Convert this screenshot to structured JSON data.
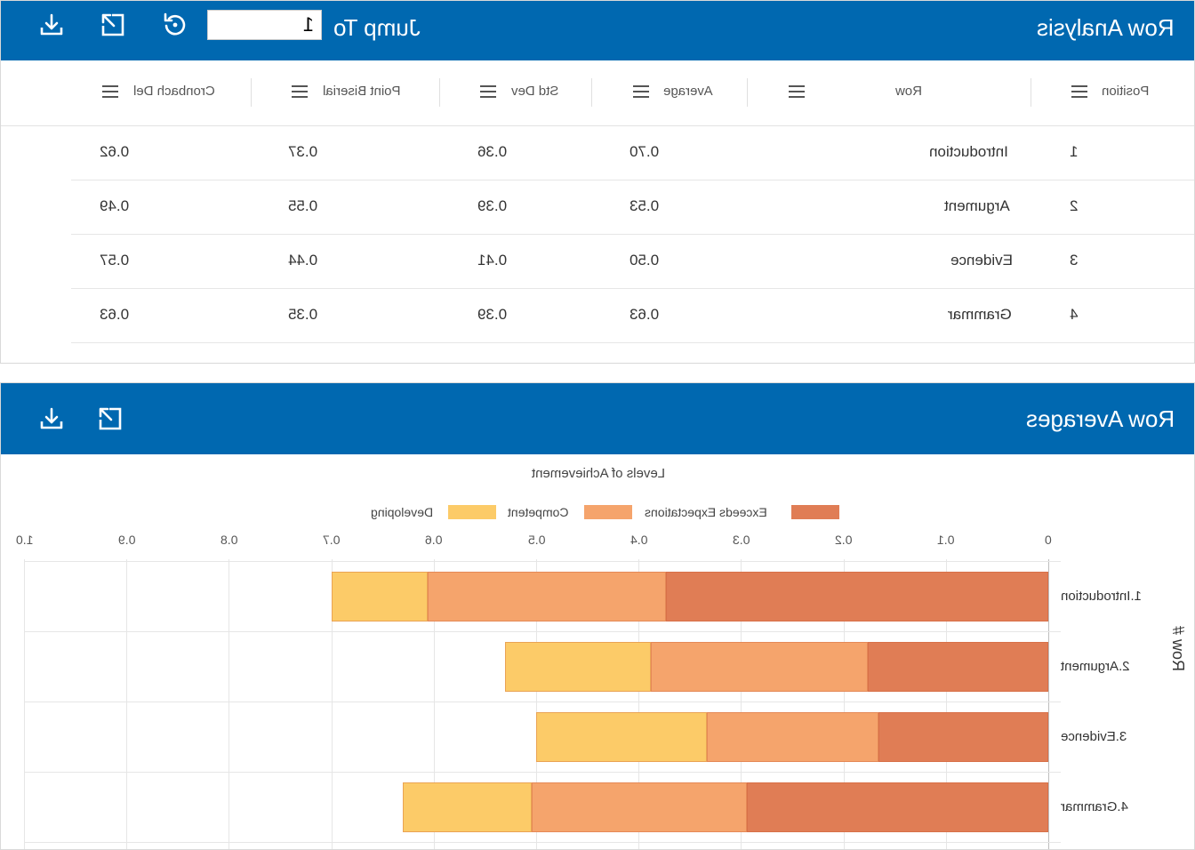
{
  "analysis": {
    "title": "Row Analysis",
    "jump_label": "Jump To",
    "jump_value": "1",
    "columns": [
      "Position",
      "Row",
      "Average",
      "Std Dev",
      "Point Biserial",
      "Cronbach Del"
    ],
    "rows": [
      {
        "position": "1",
        "row": "Introduction",
        "average": "0.70",
        "std_dev": "0.36",
        "point_biserial": "0.37",
        "cronbach_del": "0.62"
      },
      {
        "position": "2",
        "row": "Argument",
        "average": "0.53",
        "std_dev": "0.39",
        "point_biserial": "0.55",
        "cronbach_del": "0.49"
      },
      {
        "position": "3",
        "row": "Evidence",
        "average": "0.50",
        "std_dev": "0.41",
        "point_biserial": "0.44",
        "cronbach_del": "0.57"
      },
      {
        "position": "4",
        "row": "Grammar",
        "average": "0.63",
        "std_dev": "0.39",
        "point_biserial": "0.35",
        "cronbach_del": "0.63"
      }
    ]
  },
  "averages": {
    "title": "Row Averages"
  },
  "icons": {
    "download": "download-icon",
    "expand": "expand-icon",
    "refresh": "refresh-icon",
    "column_menu": "menu-icon"
  },
  "colors": {
    "header_bg": "#0068b0",
    "exceeds": "#e07d55",
    "competent": "#f5a46c",
    "developing": "#fccb68"
  },
  "chart_data": {
    "type": "bar",
    "orientation": "horizontal",
    "stacked": true,
    "title": "Levels of Achievement",
    "ylabel": "Row #",
    "xlim": [
      0,
      1.0
    ],
    "xticks": [
      "0",
      "0.1",
      "0.2",
      "0.3",
      "0.4",
      "0.5",
      "0.6",
      "0.7",
      "0.8",
      "0.9",
      "1.0"
    ],
    "categories": [
      "1.Introduction",
      "2.Argument",
      "3.Evidence",
      "4.Grammar"
    ],
    "series": [
      {
        "name": "Exceeds Expectations",
        "values": [
          0.373,
          0.176,
          0.166,
          0.294
        ]
      },
      {
        "name": "Competent",
        "values": [
          0.233,
          0.212,
          0.167,
          0.21
        ]
      },
      {
        "name": "Developing",
        "values": [
          0.094,
          0.142,
          0.167,
          0.126
        ]
      }
    ],
    "legend_position": "top",
    "grid": true
  }
}
